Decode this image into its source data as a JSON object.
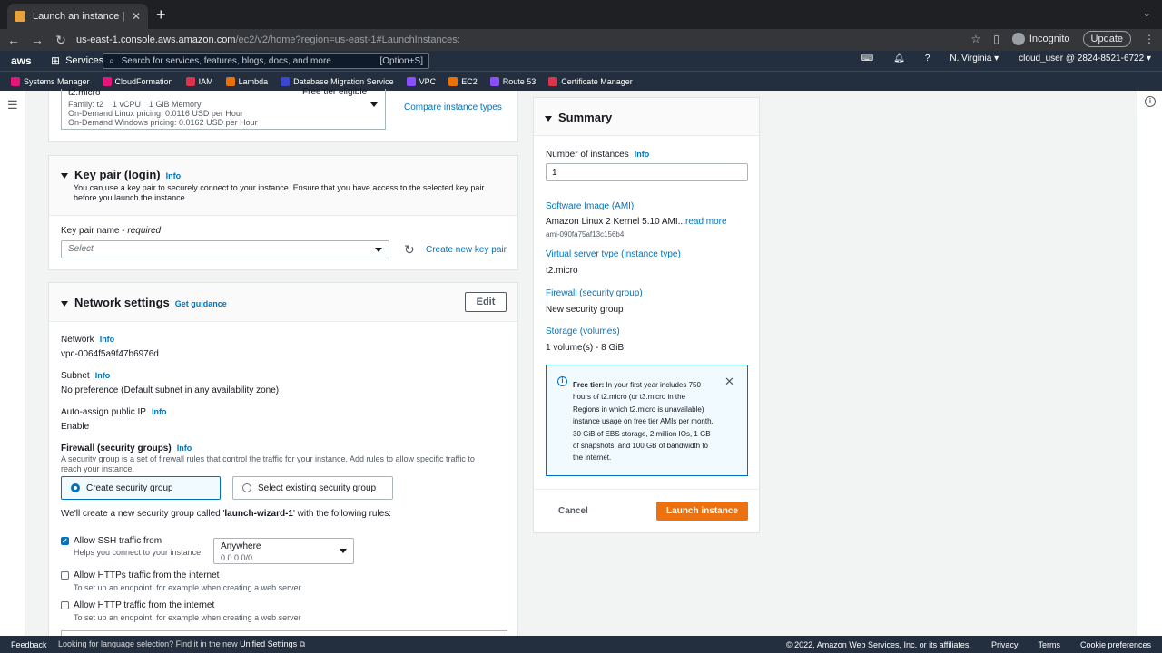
{
  "browser": {
    "tab_title": "Launch an instance | EC2 Mana",
    "url_host": "us-east-1.console.aws.amazon.com",
    "url_path": "/ec2/v2/home?region=us-east-1#LaunchInstances:",
    "incognito": "Incognito",
    "update": "Update"
  },
  "aws_header": {
    "logo": "aws",
    "services": "Services",
    "search_placeholder": "Search for services, features, blogs, docs, and more",
    "search_shortcut": "[Option+S]",
    "region": "N. Virginia",
    "account": "cloud_user @ 2824-8521-6722"
  },
  "favorites": [
    {
      "label": "Systems Manager",
      "color": "#e7157b"
    },
    {
      "label": "CloudFormation",
      "color": "#e7157b"
    },
    {
      "label": "IAM",
      "color": "#dd344c"
    },
    {
      "label": "Lambda",
      "color": "#ed7100"
    },
    {
      "label": "Database Migration Service",
      "color": "#3b48cc"
    },
    {
      "label": "VPC",
      "color": "#8c4fff"
    },
    {
      "label": "EC2",
      "color": "#ed7100"
    },
    {
      "label": "Route 53",
      "color": "#8c4fff"
    },
    {
      "label": "Certificate Manager",
      "color": "#dd344c"
    }
  ],
  "instance_type": {
    "name": "t2.micro",
    "free_tier": "Free tier eligible",
    "family": "Family: t2",
    "vcpu": "1 vCPU",
    "memory": "1 GiB Memory",
    "linux_pricing": "On-Demand Linux pricing: 0.0116 USD per Hour",
    "windows_pricing": "On-Demand Windows pricing: 0.0162 USD per Hour",
    "compare_link": "Compare instance types"
  },
  "key_pair": {
    "title": "Key pair (login)",
    "info": "Info",
    "description": "You can use a key pair to securely connect to your instance. Ensure that you have access to the selected key pair before you launch the instance.",
    "name_label": "Key pair name - ",
    "required": "required",
    "select_placeholder": "Select",
    "create_link": "Create new key pair"
  },
  "network": {
    "title": "Network settings",
    "guidance": "Get guidance",
    "edit": "Edit",
    "network_label": "Network",
    "network_value": "vpc-0064f5a9f47b6976d",
    "subnet_label": "Subnet",
    "subnet_value": "No preference (Default subnet in any availability zone)",
    "public_ip_label": "Auto-assign public IP",
    "public_ip_value": "Enable",
    "info": "Info",
    "firewall_label": "Firewall (security groups)",
    "firewall_desc": "A security group is a set of firewall rules that control the traffic for your instance. Add rules to allow specific traffic to reach your instance.",
    "create_sg": "Create security group",
    "select_sg": "Select existing security group",
    "new_sg_prefix": "We'll create a new security group called '",
    "new_sg_name": "launch-wizard-1",
    "new_sg_suffix": "' with the following rules:",
    "ssh_label": "Allow SSH traffic from",
    "ssh_help": "Helps you connect to your instance",
    "ssh_source": "Anywhere",
    "ssh_cidr": "0.0.0.0/0",
    "https_label": "Allow HTTPs traffic from the internet",
    "https_help": "To set up an endpoint, for example when creating a web server",
    "http_label": "Allow HTTP traffic from the internet",
    "http_help": "To set up an endpoint, for example when creating a web server"
  },
  "summary": {
    "title": "Summary",
    "num_label": "Number of instances",
    "info": "Info",
    "num_value": "1",
    "ami_label": "Software Image (AMI)",
    "ami_value": "Amazon Linux 2 Kernel 5.10 AMI...",
    "ami_more": "read more",
    "ami_id": "ami-090fa75af13c156b4",
    "type_label": "Virtual server type (instance type)",
    "type_value": "t2.micro",
    "firewall_label": "Firewall (security group)",
    "firewall_value": "New security group",
    "storage_label": "Storage (volumes)",
    "storage_value": "1 volume(s) - 8 GiB",
    "free_tier_bold": "Free tier:",
    "free_tier_text": " In your first year includes 750 hours of t2.micro (or t3.micro in the Regions in which t2.micro is unavailable) instance usage on free tier AMIs per month, 30 GiB of EBS storage, 2 million IOs, 1 GB of snapshots, and 100 GB of bandwidth to the internet.",
    "cancel": "Cancel",
    "launch": "Launch instance"
  },
  "footer": {
    "feedback": "Feedback",
    "lang_text": "Looking for language selection? Find it in the new ",
    "lang_link": "Unified Settings",
    "copyright": "© 2022, Amazon Web Services, Inc. or its affiliates.",
    "privacy": "Privacy",
    "terms": "Terms",
    "cookies": "Cookie preferences"
  },
  "colors": {
    "accent": "#0073bb",
    "launch_button": "#ec7211",
    "header": "#232f3e"
  }
}
